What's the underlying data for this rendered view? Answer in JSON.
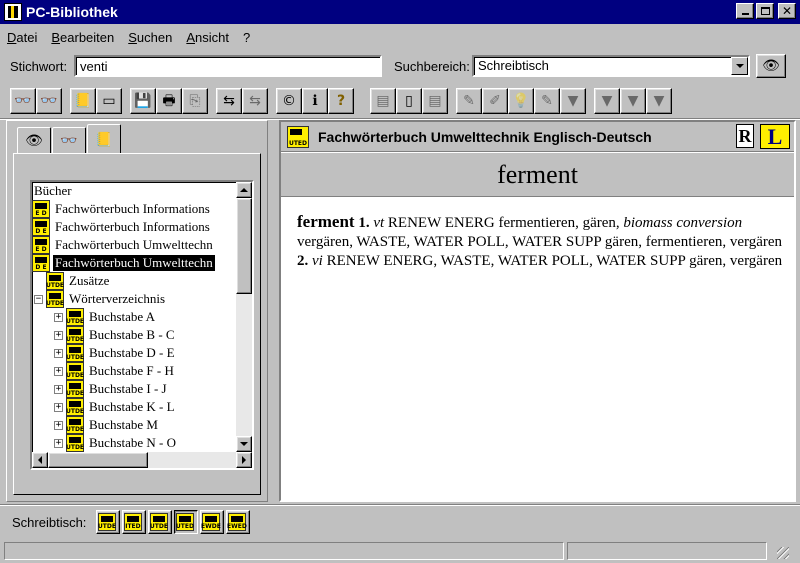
{
  "window": {
    "title": "PC-Bibliothek"
  },
  "menu": [
    "Datei",
    "Bearbeiten",
    "Suchen",
    "Ansicht",
    "?"
  ],
  "search": {
    "stichwort_label": "Stichwort:",
    "stichwort_value": "venti",
    "suchbereich_label": "Suchbereich:",
    "suchbereich_value": "Schreibtisch"
  },
  "toolbar": [
    {
      "name": "search-binoculars-icon",
      "glyph": "👓",
      "enabled": true
    },
    {
      "name": "search-advanced-icon",
      "glyph": "👓",
      "enabled": true
    },
    {
      "name": "bookshelf-icon",
      "glyph": "📒",
      "enabled": true
    },
    {
      "name": "window-icon",
      "glyph": "▭",
      "enabled": true
    },
    {
      "name": "save-icon",
      "glyph": "💾",
      "enabled": true
    },
    {
      "name": "print-icon",
      "glyph": "🖶",
      "enabled": true
    },
    {
      "name": "copy-icon",
      "glyph": "⎘",
      "enabled": false
    },
    {
      "name": "transfer-icon",
      "glyph": "⇆",
      "enabled": true
    },
    {
      "name": "transfer-disabled-icon",
      "glyph": "⇆",
      "enabled": false
    },
    {
      "name": "copyright-icon",
      "glyph": "©",
      "enabled": true
    },
    {
      "name": "info-book-icon",
      "glyph": "ℹ",
      "enabled": true
    },
    {
      "name": "help-icon",
      "glyph": "?",
      "enabled": true
    },
    {
      "name": "note-icon",
      "glyph": "▤",
      "enabled": false
    },
    {
      "name": "page-icon",
      "glyph": "▯",
      "enabled": true
    },
    {
      "name": "page-list-icon",
      "glyph": "▤",
      "enabled": false
    },
    {
      "name": "pen-icon",
      "glyph": "✎",
      "enabled": false
    },
    {
      "name": "edit-icon",
      "glyph": "✐",
      "enabled": false
    },
    {
      "name": "bulb-icon",
      "glyph": "💡",
      "enabled": false
    },
    {
      "name": "marker-icon",
      "glyph": "✎",
      "enabled": false
    },
    {
      "name": "bookmark-icon",
      "glyph": "▼",
      "enabled": false
    },
    {
      "name": "bookmark-2-icon",
      "glyph": "▼",
      "enabled": false
    },
    {
      "name": "bookmark-3-icon",
      "glyph": "▼",
      "enabled": false
    },
    {
      "name": "bookmark-4-icon",
      "glyph": "▼",
      "enabled": false
    }
  ],
  "tabs": [
    {
      "name": "eye-icon",
      "glyph": "👁"
    },
    {
      "name": "binoculars-icon",
      "glyph": "👓"
    },
    {
      "name": "books-icon",
      "glyph": "📒"
    }
  ],
  "tree": {
    "root": "Bücher",
    "items": [
      {
        "label": "Fachwörterbuch Informations",
        "badge": "E D",
        "selected": false
      },
      {
        "label": "Fachwörterbuch Informations",
        "badge": "D E",
        "selected": false
      },
      {
        "label": "Fachwörterbuch Umwelttechn",
        "badge": "E D",
        "selected": false
      },
      {
        "label": "Fachwörterbuch Umwelttechn",
        "badge": "D E",
        "selected": true
      },
      {
        "label": "Zusätze",
        "badge": "UTDE",
        "selected": false
      },
      {
        "label": "Wörterverzeichnis",
        "badge": "UTDE",
        "selected": false
      }
    ],
    "letters": [
      "Buchstabe A",
      "Buchstabe B - C",
      "Buchstabe D - E",
      "Buchstabe F - H",
      "Buchstabe I - J",
      "Buchstabe K - L",
      "Buchstabe M",
      "Buchstabe N - O"
    ],
    "letter_badge": "UTDE"
  },
  "dictionary": {
    "badge": "UTED",
    "title": "Fachwörterbuch Umwelttechnik Englisch-Deutsch",
    "publisher_logo": "R",
    "lang_logo": "L",
    "headword": "ferment"
  },
  "entry": {
    "hw": "ferment",
    "s1_num": "1.",
    "s1_pos": "vt",
    "s1_a": "RENEW ENERG fermentieren, gären,",
    "s1_it": "biomass conversion",
    "s1_b": "vergären, WASTE, WATER POLL, WATER SUPP gären, fermentieren, vergären",
    "s2_num": "2.",
    "s2_pos": "vi",
    "s2_a": "RENEW ENERG, WASTE, WATER POLL, WATER SUPP gären, vergären"
  },
  "shelf": {
    "label": "Schreibtisch:",
    "books": [
      "UTDE",
      "ITED",
      "UTDE",
      "UTED",
      "EWDE",
      "EWED"
    ]
  }
}
